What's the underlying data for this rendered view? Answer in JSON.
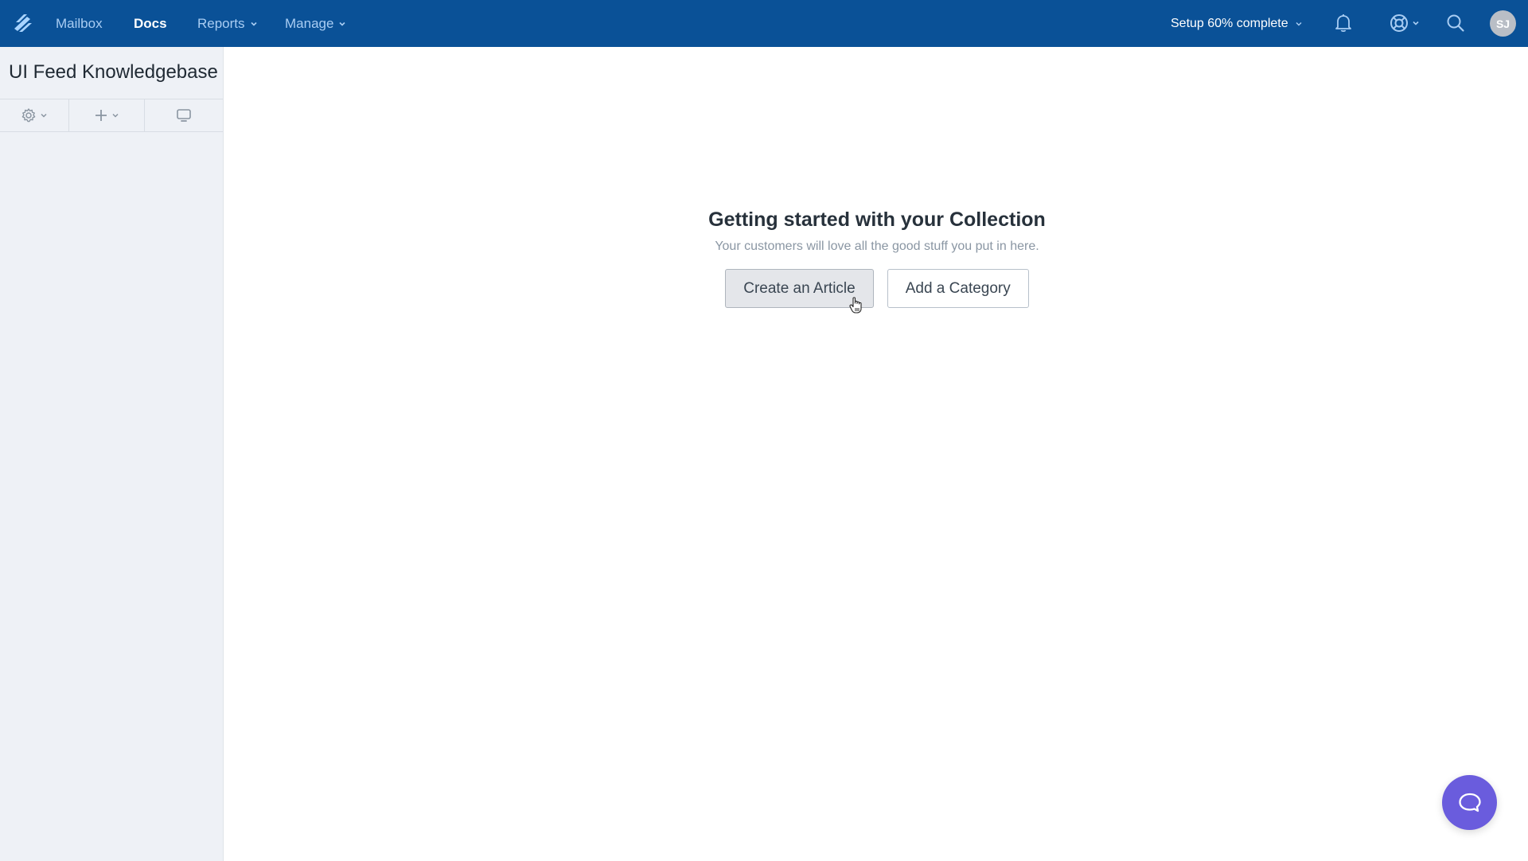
{
  "topbar": {
    "logo_icon": "helpscout-logo-icon",
    "nav": [
      {
        "label": "Mailbox",
        "active": false,
        "dropdown": false
      },
      {
        "label": "Docs",
        "active": true,
        "dropdown": false
      },
      {
        "label": "Reports",
        "active": false,
        "dropdown": true
      },
      {
        "label": "Manage",
        "active": false,
        "dropdown": true
      }
    ],
    "setup_label": "Setup 60% complete",
    "setup_progress_percent": 60,
    "icons": [
      "bell-icon",
      "help-lifebuoy-icon",
      "search-icon"
    ],
    "avatar_initials": "SJ"
  },
  "sidebar": {
    "title": "UI Feed Knowledgebase",
    "toolbar": [
      {
        "icon": "gear-icon",
        "dropdown": true
      },
      {
        "icon": "plus-icon",
        "dropdown": true
      },
      {
        "icon": "monitor-icon",
        "dropdown": false
      }
    ]
  },
  "main": {
    "heading": "Getting started with your Collection",
    "subtext": "Your customers will love all the good stuff you put in here.",
    "buttons": {
      "create_article": "Create an Article",
      "add_category": "Add a Category"
    }
  },
  "beacon": {
    "icon": "chat-bubble-icon"
  },
  "colors": {
    "topbar": "#0a5197",
    "nav_inactive": "#a9cdf3",
    "sidebar_bg": "#eef1f6",
    "beacon": "#6a5cdd"
  }
}
